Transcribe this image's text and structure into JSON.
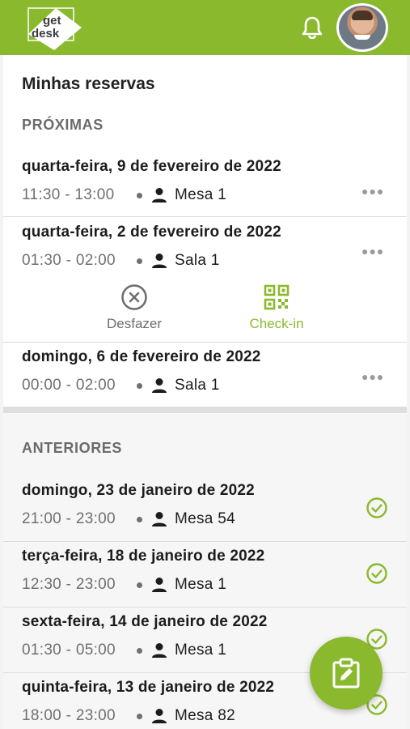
{
  "header": {
    "logo_line1": "get",
    "logo_line2": "desk",
    "brand_color": "#8ab92d",
    "notification_icon": "bell-icon",
    "avatar_icon": "user-avatar"
  },
  "page": {
    "title": "Minhas reservas"
  },
  "upcoming": {
    "title": "PRÓXIMAS",
    "items": [
      {
        "date": "quarta-feira, 9 de fevereiro de 2022",
        "time": "11:30 - 13:00",
        "place": "Mesa 1"
      },
      {
        "date": "quarta-feira, 2 de fevereiro de 2022",
        "time": "01:30 - 02:00",
        "place": "Sala 1"
      },
      {
        "date": "domingo, 6 de fevereiro de 2022",
        "time": "00:00 - 02:00",
        "place": "Sala 1"
      }
    ],
    "actions": {
      "undo_label": "Desfazer",
      "checkin_label": "Check-in"
    }
  },
  "past": {
    "title": "ANTERIORES",
    "items": [
      {
        "date": "domingo, 23 de janeiro de 2022",
        "time": "21:00 - 23:00",
        "place": "Mesa 54"
      },
      {
        "date": "terça-feira, 18 de janeiro de 2022",
        "time": "12:30 - 23:00",
        "place": "Mesa 1"
      },
      {
        "date": "sexta-feira, 14 de janeiro de 2022",
        "time": "01:30 - 05:00",
        "place": "Mesa 1"
      },
      {
        "date": "quinta-feira, 13 de janeiro de 2022",
        "time": "18:00 - 23:00",
        "place": "Mesa 82"
      }
    ]
  },
  "fab": {
    "icon": "edit-clipboard-icon"
  }
}
